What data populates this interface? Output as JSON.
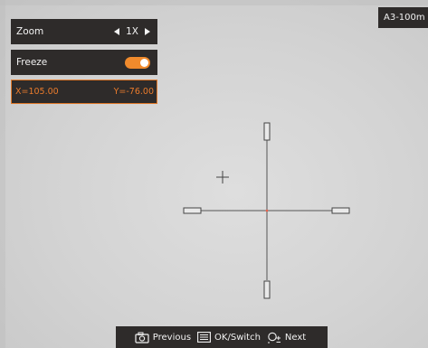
{
  "menu": {
    "zoom": {
      "label": "Zoom",
      "value": "1X"
    },
    "freeze": {
      "label": "Freeze",
      "enabled": true
    }
  },
  "coordinates": {
    "x": "X=105.00",
    "y": "Y=-76.00"
  },
  "device": {
    "model": "A3-100m"
  },
  "hints": {
    "previous": "Previous",
    "ok_switch": "OK/Switch",
    "next": "Next"
  },
  "colors": {
    "accent": "#f08a2c",
    "panel_bg": "#2e2b2a",
    "reticle_line": "#555555",
    "reticle_center": "#e8604a"
  },
  "icons": {
    "previous": "camera-icon",
    "ok_switch": "menu-list-icon",
    "next": "zoom-plus-minus-icon"
  }
}
